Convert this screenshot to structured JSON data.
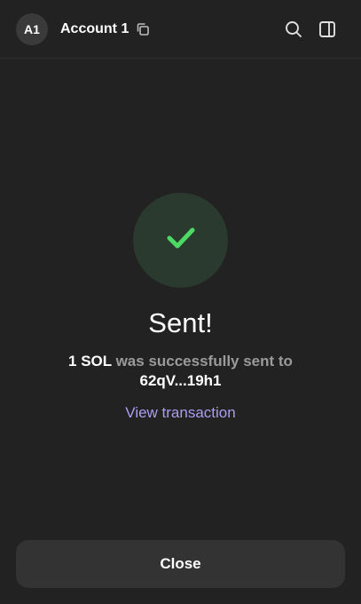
{
  "header": {
    "avatar_initials": "A1",
    "account_name": "Account 1",
    "icons": {
      "copy": "copy-icon",
      "search": "search-icon",
      "sidebar": "sidebar-toggle-icon"
    }
  },
  "result": {
    "status_icon": "checkmark-icon",
    "title": "Sent!",
    "amount": "1 SOL",
    "message_middle": " was successfully sent to ",
    "recipient": "62qV...19h1",
    "view_transaction_label": "View transaction"
  },
  "footer": {
    "close_label": "Close"
  },
  "colors": {
    "background": "#222222",
    "success_green": "#4cd964",
    "success_circle": "#2b3a2e",
    "link_purple": "#a99ef0",
    "muted_text": "#9b9b9b",
    "button_bg": "#333333"
  }
}
